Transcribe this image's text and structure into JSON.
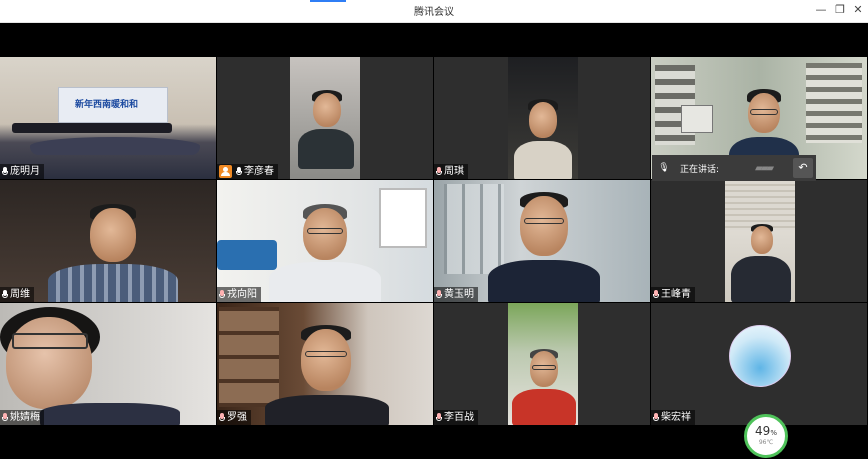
{
  "window": {
    "title": "腾讯会议",
    "controls": {
      "minimize": "—",
      "restore": "❐",
      "close": "✕"
    }
  },
  "tiles": [
    {
      "name": "庞明月",
      "mic": "active"
    },
    {
      "name": "李彦春",
      "mic": "active",
      "host": true
    },
    {
      "name": "周琪",
      "mic": "muted"
    },
    {
      "name": "",
      "mic": "none"
    },
    {
      "name": "周维",
      "mic": "active"
    },
    {
      "name": "戎向阳",
      "mic": "muted"
    },
    {
      "name": "黄玉明",
      "mic": "muted"
    },
    {
      "name": "王峰青",
      "mic": "muted"
    },
    {
      "name": "姚婧梅",
      "mic": "muted"
    },
    {
      "name": "罗强",
      "mic": "muted"
    },
    {
      "name": "李百战",
      "mic": "muted"
    },
    {
      "name": "柴宏祥",
      "mic": "muted"
    }
  ],
  "speaking": {
    "label": "正在讲话:"
  },
  "banner": {
    "text": "新年西南暖和和"
  },
  "stats": {
    "percent": "49",
    "percent_unit": "%",
    "temperature": "96℃"
  },
  "colors": {
    "accent": "#2f7ef5",
    "host_badge": "#f08a24",
    "progress_ring": "#4fc35a"
  }
}
